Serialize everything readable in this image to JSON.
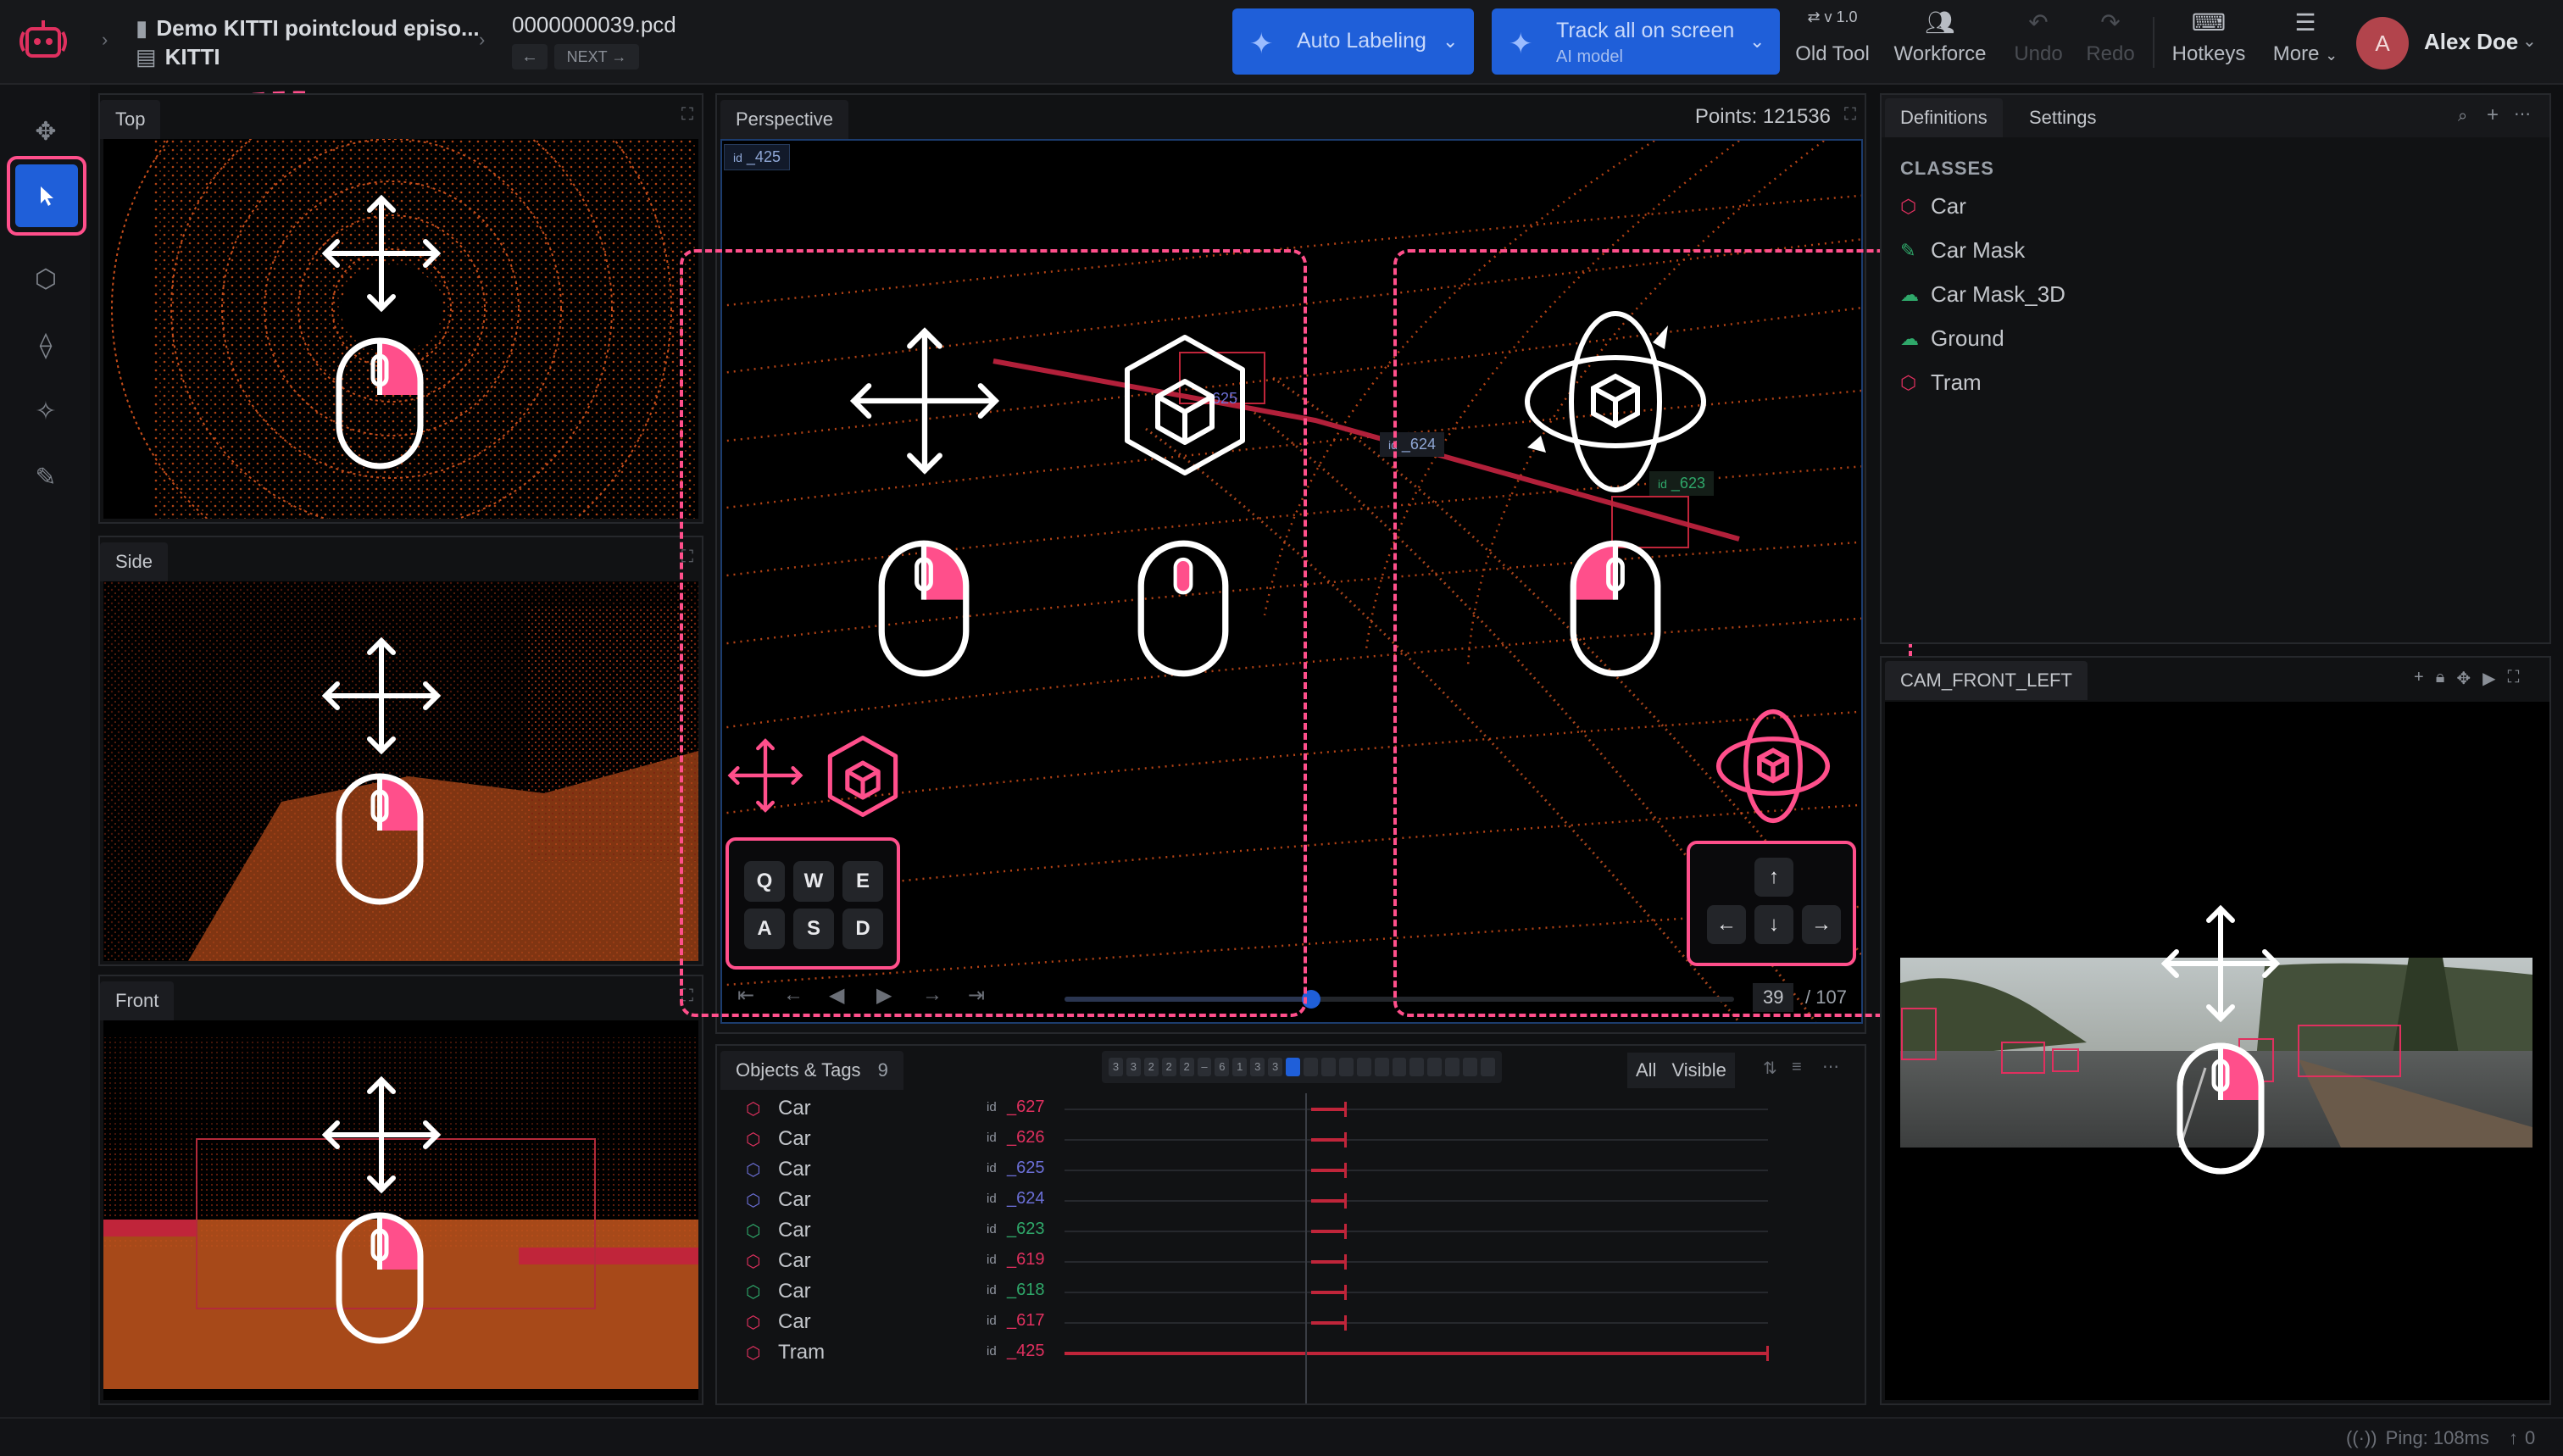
{
  "header": {
    "project_title": "Demo KITTI pointcloud episo...",
    "project_subtitle": "KITTI",
    "file_name": "0000000039.pcd",
    "next_label": "NEXT",
    "auto_labeling_label": "Auto Labeling",
    "track_label": "Track all on screen",
    "track_sub": "AI model",
    "old_tool_version": "v 1.0",
    "old_tool_label": "Old Tool",
    "workforce_label": "Workforce",
    "undo_label": "Undo",
    "redo_label": "Redo",
    "hotkeys_label": "Hotkeys",
    "more_label": "More",
    "user_initial": "A",
    "user_name": "Alex Doe"
  },
  "views": {
    "top_label": "Top",
    "side_label": "Side",
    "front_label": "Front",
    "perspective_label": "Perspective",
    "points_label": "Points: 121536",
    "perspective_id": "_425",
    "id_prefix": "id",
    "id_624": "_624",
    "id_623": "_623",
    "id_625": "625"
  },
  "keys": {
    "wasd": [
      "Q",
      "W",
      "E",
      "A",
      "S",
      "D"
    ],
    "arrows": [
      "↑",
      "←",
      "↓",
      "→"
    ]
  },
  "playback": {
    "frame_current": "39",
    "frame_total": "/ 107"
  },
  "objects": {
    "title": "Objects & Tags",
    "count": "9",
    "filter_all": "All",
    "filter_visible": "Visible",
    "frame_strip": [
      "3",
      "3",
      "2",
      "2",
      "2",
      "–",
      "6",
      "1",
      "3",
      "3"
    ],
    "rows": [
      {
        "cls": "Car",
        "id": "_627",
        "color": "#e0305f",
        "track_end": 0.4
      },
      {
        "cls": "Car",
        "id": "_626",
        "color": "#e0305f",
        "track_end": 0.4
      },
      {
        "cls": "Car",
        "id": "_625",
        "color": "#6b6fd6",
        "track_end": 0.4
      },
      {
        "cls": "Car",
        "id": "_624",
        "color": "#6b6fd6",
        "track_end": 0.4
      },
      {
        "cls": "Car",
        "id": "_623",
        "color": "#2fa86a",
        "track_end": 0.4
      },
      {
        "cls": "Car",
        "id": "_619",
        "color": "#e0305f",
        "track_end": 0.4
      },
      {
        "cls": "Car",
        "id": "_618",
        "color": "#2fa86a",
        "track_end": 0.4
      },
      {
        "cls": "Car",
        "id": "_617",
        "color": "#e0305f",
        "track_end": 0.4
      },
      {
        "cls": "Tram",
        "id": "_425",
        "color": "#e0305f",
        "track_end": 1.0
      }
    ]
  },
  "sidebar": {
    "tab_definitions": "Definitions",
    "tab_settings": "Settings",
    "classes_title": "CLASSES",
    "classes": [
      {
        "name": "Car",
        "color": "#e0305f",
        "icon": "cube-icon"
      },
      {
        "name": "Car Mask",
        "color": "#2fa86a",
        "icon": "brush-icon"
      },
      {
        "name": "Car Mask_3D",
        "color": "#2fa86a",
        "icon": "cloud-icon"
      },
      {
        "name": "Ground",
        "color": "#2fa86a",
        "icon": "cloud-icon"
      },
      {
        "name": "Tram",
        "color": "#e0305f",
        "icon": "cube-icon"
      }
    ]
  },
  "camera": {
    "label": "CAM_FRONT_LEFT"
  },
  "status": {
    "ping": "Ping: 108ms",
    "upload_count": "0"
  },
  "colors": {
    "accent": "#ff4f8b",
    "primary": "#1f5fd9",
    "point": "#d2551c"
  }
}
